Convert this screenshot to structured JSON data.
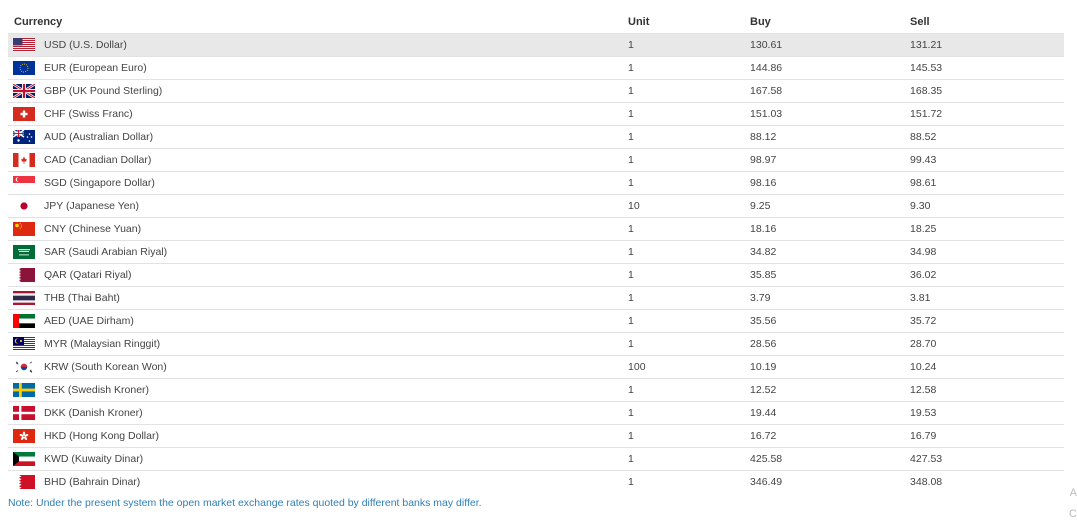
{
  "table": {
    "headers": {
      "currency": "Currency",
      "unit": "Unit",
      "buy": "Buy",
      "sell": "Sell"
    },
    "rows": [
      {
        "flag": "us-flag-icon",
        "currency": "USD (U.S. Dollar)",
        "unit": "1",
        "buy": "130.61",
        "sell": "131.21"
      },
      {
        "flag": "eu-flag-icon",
        "currency": "EUR (European Euro)",
        "unit": "1",
        "buy": "144.86",
        "sell": "145.53"
      },
      {
        "flag": "gb-flag-icon",
        "currency": "GBP (UK Pound Sterling)",
        "unit": "1",
        "buy": "167.58",
        "sell": "168.35"
      },
      {
        "flag": "ch-flag-icon",
        "currency": "CHF (Swiss Franc)",
        "unit": "1",
        "buy": "151.03",
        "sell": "151.72"
      },
      {
        "flag": "au-flag-icon",
        "currency": "AUD (Australian Dollar)",
        "unit": "1",
        "buy": "88.12",
        "sell": "88.52"
      },
      {
        "flag": "ca-flag-icon",
        "currency": "CAD (Canadian Dollar)",
        "unit": "1",
        "buy": "98.97",
        "sell": "99.43"
      },
      {
        "flag": "sg-flag-icon",
        "currency": "SGD (Singapore Dollar)",
        "unit": "1",
        "buy": "98.16",
        "sell": "98.61"
      },
      {
        "flag": "jp-flag-icon",
        "currency": "JPY (Japanese Yen)",
        "unit": "10",
        "buy": "9.25",
        "sell": "9.30"
      },
      {
        "flag": "cn-flag-icon",
        "currency": "CNY (Chinese Yuan)",
        "unit": "1",
        "buy": "18.16",
        "sell": "18.25"
      },
      {
        "flag": "sa-flag-icon",
        "currency": "SAR (Saudi Arabian Riyal)",
        "unit": "1",
        "buy": "34.82",
        "sell": "34.98"
      },
      {
        "flag": "qa-flag-icon",
        "currency": "QAR (Qatari Riyal)",
        "unit": "1",
        "buy": "35.85",
        "sell": "36.02"
      },
      {
        "flag": "th-flag-icon",
        "currency": "THB (Thai Baht)",
        "unit": "1",
        "buy": "3.79",
        "sell": "3.81"
      },
      {
        "flag": "ae-flag-icon",
        "currency": "AED (UAE Dirham)",
        "unit": "1",
        "buy": "35.56",
        "sell": "35.72"
      },
      {
        "flag": "my-flag-icon",
        "currency": "MYR (Malaysian Ringgit)",
        "unit": "1",
        "buy": "28.56",
        "sell": "28.70"
      },
      {
        "flag": "kr-flag-icon",
        "currency": "KRW (South Korean Won)",
        "unit": "100",
        "buy": "10.19",
        "sell": "10.24"
      },
      {
        "flag": "se-flag-icon",
        "currency": "SEK (Swedish Kroner)",
        "unit": "1",
        "buy": "12.52",
        "sell": "12.58"
      },
      {
        "flag": "dk-flag-icon",
        "currency": "DKK (Danish Kroner)",
        "unit": "1",
        "buy": "19.44",
        "sell": "19.53"
      },
      {
        "flag": "hk-flag-icon",
        "currency": "HKD (Hong Kong Dollar)",
        "unit": "1",
        "buy": "16.72",
        "sell": "16.79"
      },
      {
        "flag": "kw-flag-icon",
        "currency": "KWD (Kuwaity Dinar)",
        "unit": "1",
        "buy": "425.58",
        "sell": "427.53"
      },
      {
        "flag": "bh-flag-icon",
        "currency": "BHD (Bahrain Dinar)",
        "unit": "1",
        "buy": "346.49",
        "sell": "348.08"
      }
    ],
    "highlight_color": "#e8e8e8"
  },
  "note": "Note: Under the present system the open market exchange rates quoted by different banks may differ.",
  "edge_glyphs": {
    "top": "A",
    "bottom": "C"
  }
}
